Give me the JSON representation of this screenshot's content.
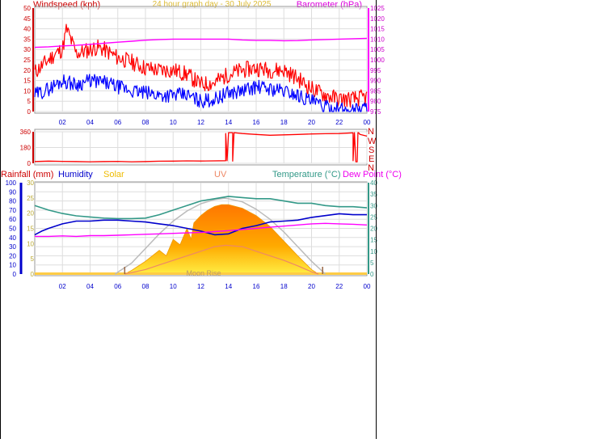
{
  "header": {
    "windspeed_label": "Windspeed (kph)",
    "title": "24 hour graph day - 30 July 2025",
    "barometer_label": "Barometer (hPa)"
  },
  "colors": {
    "wind_gust": "#ff0000",
    "wind_avg": "#0000ff",
    "barometer": "#ff00ff",
    "direction": "#ff0000",
    "humidity": "#0000cc",
    "temperature": "#339988",
    "dewpoint": "#ff00ff",
    "solar_fill": "#ffaa00",
    "solar_max": "#bbbbbb",
    "uv": "#ee8866",
    "axis_x": "#0000cc",
    "grid": "#dddddd"
  },
  "chart_data": [
    {
      "type": "line",
      "name": "wind-barometer",
      "x_tick_labels": [
        "02",
        "04",
        "06",
        "08",
        "10",
        "12",
        "14",
        "16",
        "18",
        "20",
        "22",
        "00"
      ],
      "y_left_ticks": [
        "0",
        "5",
        "10",
        "15",
        "20",
        "25",
        "30",
        "35",
        "40",
        "45",
        "50"
      ],
      "y_right_ticks": [
        "975",
        "980",
        "985",
        "990",
        "995",
        "1000",
        "1005",
        "1010",
        "1015",
        "1020",
        "1025"
      ],
      "ylim_left": [
        0,
        50
      ],
      "ylim_right": [
        975,
        1025
      ],
      "xlim_hours": [
        0,
        24
      ],
      "series": [
        {
          "name": "Windspeed (kph)",
          "role": "gust",
          "x_hours": [
            0,
            1,
            1.5,
            2,
            2.3,
            3,
            4,
            4.5,
            5,
            6,
            7,
            8,
            9,
            10,
            11,
            12,
            13,
            14,
            15,
            16,
            17,
            18,
            19,
            20,
            21,
            22,
            23,
            24
          ],
          "values": [
            19,
            25,
            28,
            30,
            40,
            28,
            30,
            31,
            30,
            26,
            24,
            21,
            20,
            20,
            18,
            13,
            14,
            18,
            20,
            21,
            20,
            20,
            16,
            11,
            8,
            6,
            6,
            7
          ]
        },
        {
          "role": "average",
          "x_hours": [
            0,
            1,
            2,
            3,
            4,
            5,
            6,
            7,
            8,
            9,
            10,
            11,
            12,
            13,
            14,
            15,
            16,
            17,
            18,
            19,
            20,
            21,
            22,
            23,
            24
          ],
          "values": [
            8,
            11,
            15,
            13,
            15,
            14,
            12,
            10,
            9,
            8,
            8,
            8,
            5,
            6,
            9,
            10,
            12,
            11,
            10,
            8,
            5,
            2,
            1,
            1,
            2
          ]
        },
        {
          "name": "Barometer (hPa)",
          "role": "barometer",
          "x_hours": [
            0,
            1,
            2,
            3,
            4,
            5,
            6,
            7,
            8,
            9,
            10,
            11,
            12,
            13,
            14,
            15,
            16,
            17,
            18,
            19,
            20,
            21,
            22,
            23,
            24
          ],
          "values": [
            1006,
            1006.3,
            1006.7,
            1007,
            1007.5,
            1008,
            1008.5,
            1009,
            1009.5,
            1009.8,
            1010,
            1010,
            1010,
            1010,
            1010,
            1009.6,
            1009.4,
            1009.4,
            1009.2,
            1009.3,
            1009.6,
            1009.8,
            1010,
            1010.2,
            1010.4
          ]
        }
      ]
    },
    {
      "type": "line",
      "name": "wind-direction",
      "y_left_ticks": [
        "0",
        "180",
        "360"
      ],
      "compass_labels": [
        "N",
        "W",
        "S",
        "E",
        "N"
      ],
      "ylim": [
        0,
        360
      ],
      "xlim_hours": [
        0,
        24
      ],
      "series": [
        {
          "x_hours": [
            0,
            1,
            2,
            3,
            4,
            5,
            6,
            7,
            8,
            9,
            10,
            11,
            12,
            13.8,
            13.8,
            13.9,
            14.0,
            14.3,
            14.3,
            14.4,
            15,
            16,
            17,
            18,
            19,
            20,
            21,
            22,
            23.0,
            23.0,
            23.1,
            23.2,
            23.3,
            23.35,
            23.4,
            23.5,
            24
          ],
          "values": [
            20,
            25,
            22,
            20,
            18,
            20,
            22,
            18,
            20,
            24,
            25,
            28,
            26,
            30,
            340,
            30,
            350,
            350,
            25,
            350,
            340,
            330,
            320,
            325,
            330,
            335,
            338,
            340,
            348,
            30,
            350,
            18,
            18,
            350,
            350,
            330,
            310
          ]
        }
      ]
    },
    {
      "type": "line",
      "name": "rain-humidity-solar-uv-temp-dew",
      "labels": {
        "rainfall": "Rainfall (mm)",
        "humidity": "Humidity",
        "solar": "Solar",
        "uv": "UV",
        "temperature": "Temperature (°C)",
        "dewpoint": "Dew Point (°C)"
      },
      "rain_ticks": [
        "0",
        "10",
        "20",
        "30",
        "40",
        "50",
        "60",
        "70",
        "80",
        "90",
        "100"
      ],
      "solar_axis_ticks": [
        "0",
        "5",
        "10",
        "15",
        "20",
        "25",
        "30"
      ],
      "temp_ticks": [
        "0",
        "5",
        "10",
        "15",
        "20",
        "25",
        "30",
        "35",
        "40"
      ],
      "moon_label": "Moon Rise",
      "xlim_hours": [
        0,
        24
      ],
      "humidity_lim": [
        0,
        100
      ],
      "temp_lim": [
        0,
        40
      ],
      "series": [
        {
          "name": "Humidity",
          "x_hours": [
            0,
            0.5,
            1,
            2,
            3,
            4,
            5,
            6,
            7,
            8,
            9,
            10,
            11,
            12,
            13,
            14,
            15,
            16,
            17,
            18,
            19,
            20,
            21,
            22,
            23,
            24
          ],
          "values": [
            43,
            47,
            50,
            55,
            58,
            58,
            59,
            59,
            58,
            57,
            55,
            53,
            50,
            47,
            43,
            44,
            50,
            53,
            57,
            58,
            59,
            62,
            64,
            66,
            65,
            65
          ]
        },
        {
          "name": "Temperature (°C)",
          "x_hours": [
            0,
            1,
            2,
            3,
            4,
            5,
            6,
            7,
            8,
            9,
            10,
            11,
            12,
            13,
            14,
            15,
            16,
            17,
            18,
            19,
            20,
            21,
            22,
            23,
            24
          ],
          "values": [
            30,
            28,
            26.5,
            25.5,
            25,
            24.5,
            24.3,
            24.3,
            24.5,
            26,
            28,
            30,
            32,
            33,
            34,
            33.5,
            33,
            33,
            32,
            31,
            31,
            30,
            29.5,
            29.5,
            29
          ]
        },
        {
          "name": "Dew Point (°C)",
          "x_hours": [
            0,
            1,
            2,
            3,
            4,
            5,
            6,
            7,
            8,
            9,
            10,
            11,
            12,
            13,
            14,
            15,
            16,
            17,
            18,
            19,
            20,
            21,
            22,
            23,
            24
          ],
          "values": [
            16.5,
            16.5,
            16.7,
            16.5,
            16.8,
            16.8,
            17,
            17.2,
            17.4,
            17.6,
            17.8,
            18,
            18.2,
            18.6,
            19,
            19.5,
            20,
            20.5,
            21,
            21.5,
            22,
            22.2,
            22,
            21.8,
            21.5
          ]
        },
        {
          "name": "Solar",
          "x_hours": [
            6.5,
            7,
            8,
            9,
            9.5,
            10,
            10.5,
            11,
            11.3,
            11.5,
            12,
            12.5,
            13,
            13.5,
            14,
            15,
            16,
            17,
            18,
            19,
            20,
            20.5
          ],
          "values": [
            0,
            40,
            140,
            260,
            200,
            380,
            320,
            500,
            380,
            560,
            640,
            700,
            740,
            760,
            760,
            720,
            640,
            520,
            360,
            200,
            50,
            0
          ]
        },
        {
          "name": "Solar max",
          "x_hours": [
            5.8,
            7,
            8,
            9,
            10,
            11,
            12,
            13,
            13.7,
            14,
            15,
            16,
            17,
            18,
            19,
            20,
            21
          ],
          "values": [
            0,
            120,
            280,
            440,
            580,
            690,
            770,
            815,
            830,
            825,
            790,
            710,
            600,
            460,
            300,
            140,
            0
          ]
        },
        {
          "name": "UV",
          "x_hours": [
            6.5,
            8,
            9,
            10,
            11,
            12,
            13,
            13.8,
            15,
            16,
            17,
            18,
            19,
            20,
            20.5
          ],
          "values": [
            0,
            1,
            2,
            3,
            4,
            5,
            6,
            6.3,
            6,
            5,
            4,
            3,
            1.8,
            0.5,
            0
          ]
        }
      ]
    }
  ]
}
